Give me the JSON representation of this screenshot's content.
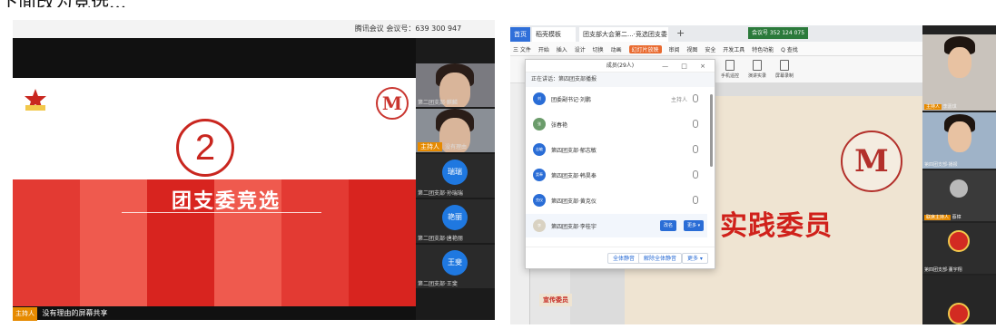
{
  "caption": "下面改为竞选...",
  "meeting": {
    "title": "腾讯会议 会议号：639 300 947",
    "slide": {
      "number": "2",
      "title": "团支委竞选"
    },
    "share_bar": {
      "host": "主持人",
      "text": "没有理由的屏幕共享"
    },
    "tiles": [
      {
        "name": "第二团支部·麒麟",
        "type": "video"
      },
      {
        "name": "没有理由",
        "host": "主持人",
        "type": "video"
      },
      {
        "name": "第二团支部·孙瑞瑞",
        "avatar": "瑞瑞",
        "type": "avatar"
      },
      {
        "name": "第二团支部·唐艳丽",
        "avatar": "艳丽",
        "type": "avatar"
      },
      {
        "name": "第二团支部·王斐",
        "avatar": "王斐",
        "type": "avatar"
      }
    ]
  },
  "wps": {
    "tabs": {
      "home": "首页",
      "doc": "稻壳模板",
      "active": "团支部大会第二...·竞选团支委"
    },
    "meeting_id": "会议号 352 124 075",
    "menu": [
      "三 文件",
      "开始",
      "插入",
      "设计",
      "切换",
      "动画",
      "幻灯片放映",
      "审阅",
      "视图",
      "安全",
      "开发工具",
      "特色功能",
      "Q 查找"
    ],
    "ribbon": [
      "手机遥控",
      "演讲实录",
      "屏幕录制"
    ],
    "slide_title": "实践委员",
    "thumb_label": "宣传委员",
    "dialog": {
      "title": "成员(29人)",
      "controls": "—  □  ×",
      "speaking": "正在讲话：第四团支部播报",
      "members": [
        {
          "name": "团委副书记·刘鹏",
          "role": "主持人",
          "av": "刘"
        },
        {
          "name": "张春艳",
          "role": "",
          "av": "张"
        },
        {
          "name": "第四团支部·郁志敏",
          "role": "",
          "av": "志敏"
        },
        {
          "name": "第四团支部·韩昊奉",
          "role": "",
          "av": "昊奉"
        },
        {
          "name": "第四团支部·黄克仪",
          "role": "",
          "av": "克仪"
        },
        {
          "name": "第四团支部·李桂宇",
          "role": "",
          "av": "李"
        }
      ],
      "action_invite": "改名",
      "action_more": "更多 ▾",
      "footer": [
        "全体静音",
        "解除全体静音",
        "更多 ▾"
      ]
    },
    "tiles": [
      {
        "name": "李嘉琪",
        "host": "主持人",
        "type": "video"
      },
      {
        "name": "第四团支部·播报",
        "type": "video2"
      },
      {
        "name": "蔡樟",
        "host": "联席主持人",
        "type": "ball"
      },
      {
        "name": "第四团支部·董宇翔",
        "type": "logo"
      },
      {
        "name": "",
        "type": "dark"
      }
    ]
  }
}
